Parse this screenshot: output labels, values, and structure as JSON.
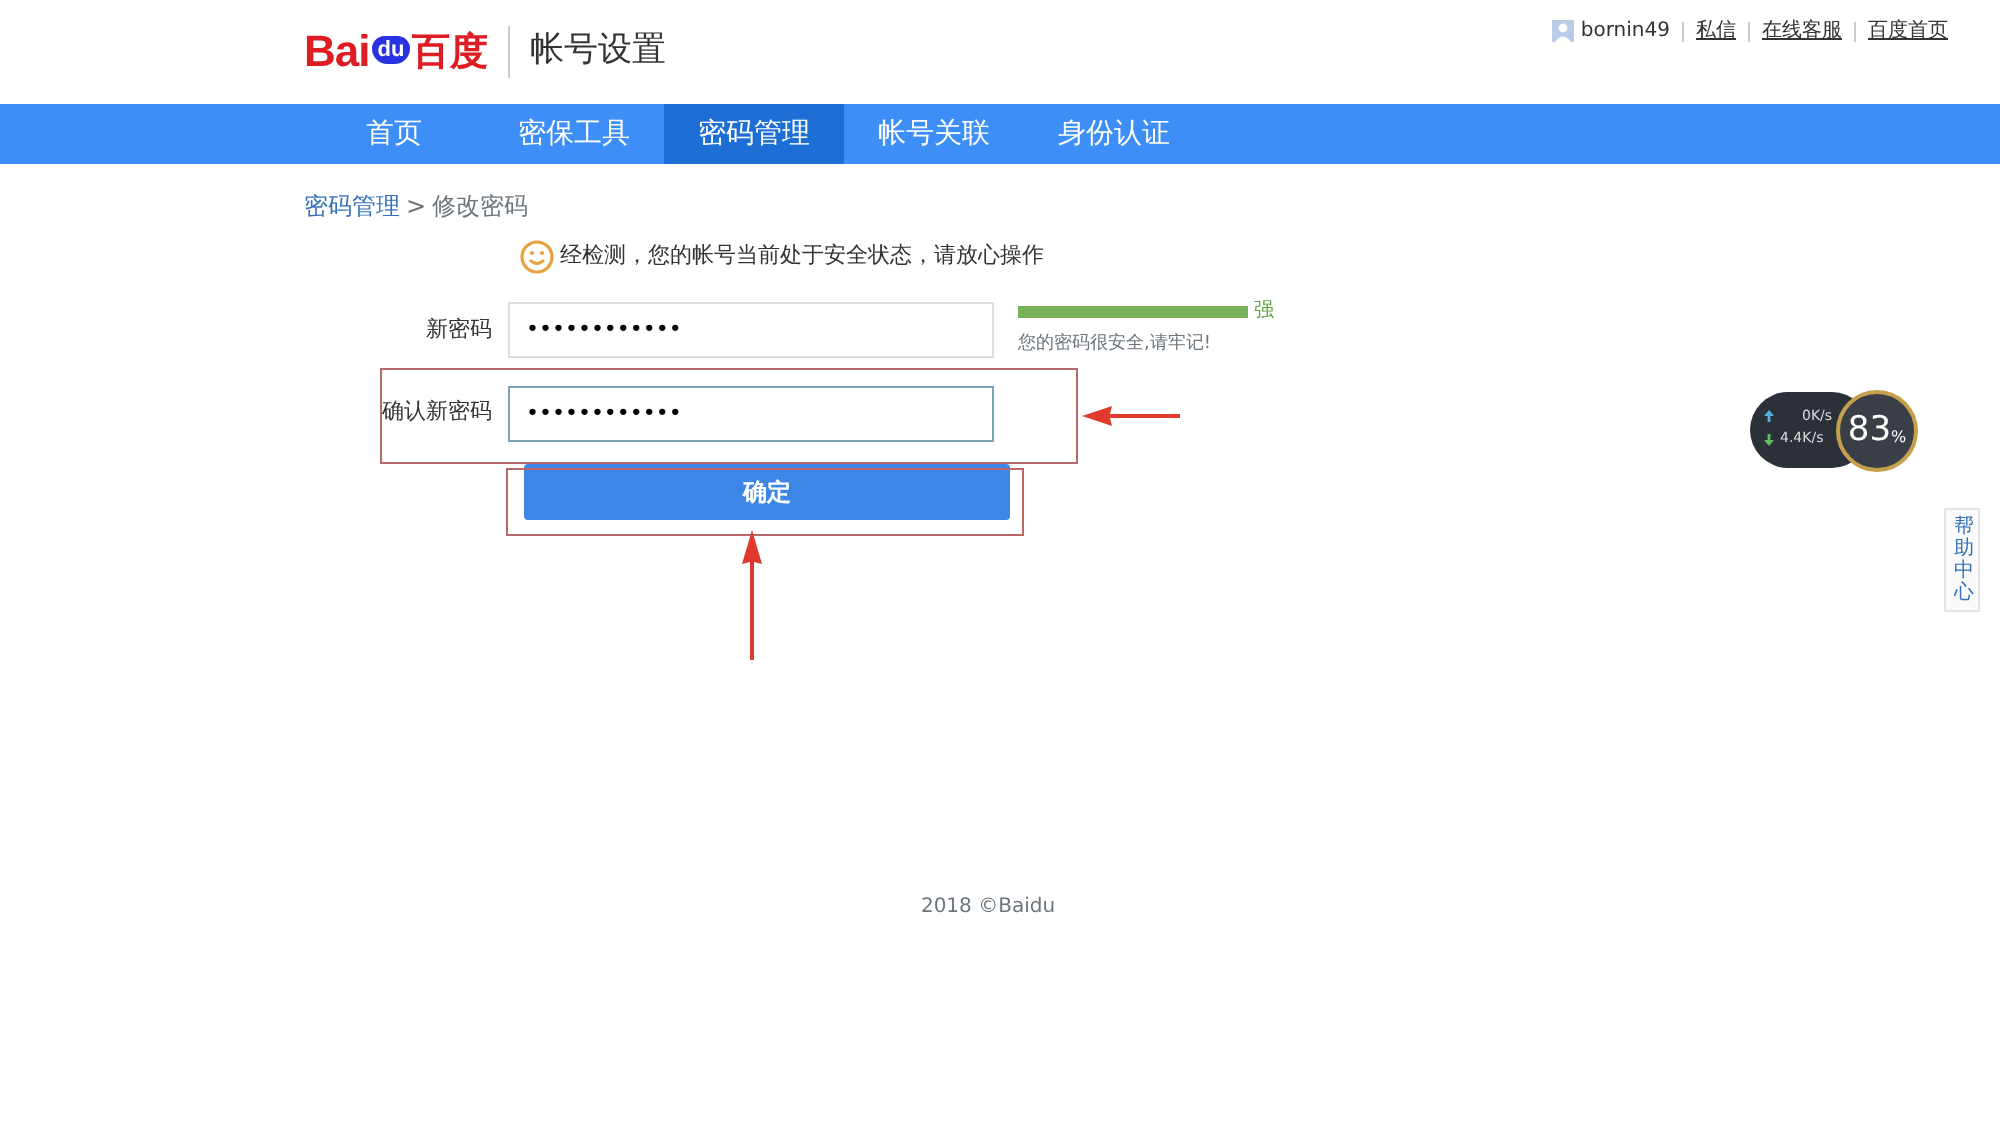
{
  "header": {
    "logo": {
      "left": "Bai",
      "paw": "du",
      "right": "百度"
    },
    "title": "帐号设置",
    "user": "bornin49",
    "links": [
      "私信",
      "在线客服",
      "百度首页"
    ]
  },
  "nav": [
    {
      "label": "首页",
      "selected": false
    },
    {
      "label": "密保工具",
      "selected": false
    },
    {
      "label": "密码管理",
      "selected": true
    },
    {
      "label": "帐号关联",
      "selected": false
    },
    {
      "label": "身份认证",
      "selected": false
    }
  ],
  "breadcrumb": {
    "parent": "密码管理",
    "separator": ">",
    "current": "修改密码"
  },
  "notice": "经检测，您的帐号当前处于安全状态，请放心操作",
  "fields": [
    {
      "label": "新密码",
      "value": "••••••••••••",
      "focused": false
    },
    {
      "label": "确认新密码",
      "value": "••••••••••••",
      "focused": true
    }
  ],
  "strength": {
    "level": 1,
    "label": "强",
    "hint": "您的密码很安全,请牢记!"
  },
  "submit": "确定",
  "footer": "2018 ©Baidu",
  "speed_widget": {
    "upload": "0K/s",
    "download": "4.4K/s",
    "percent": "83",
    "unit": "%"
  },
  "help_tab": "帮助中心"
}
